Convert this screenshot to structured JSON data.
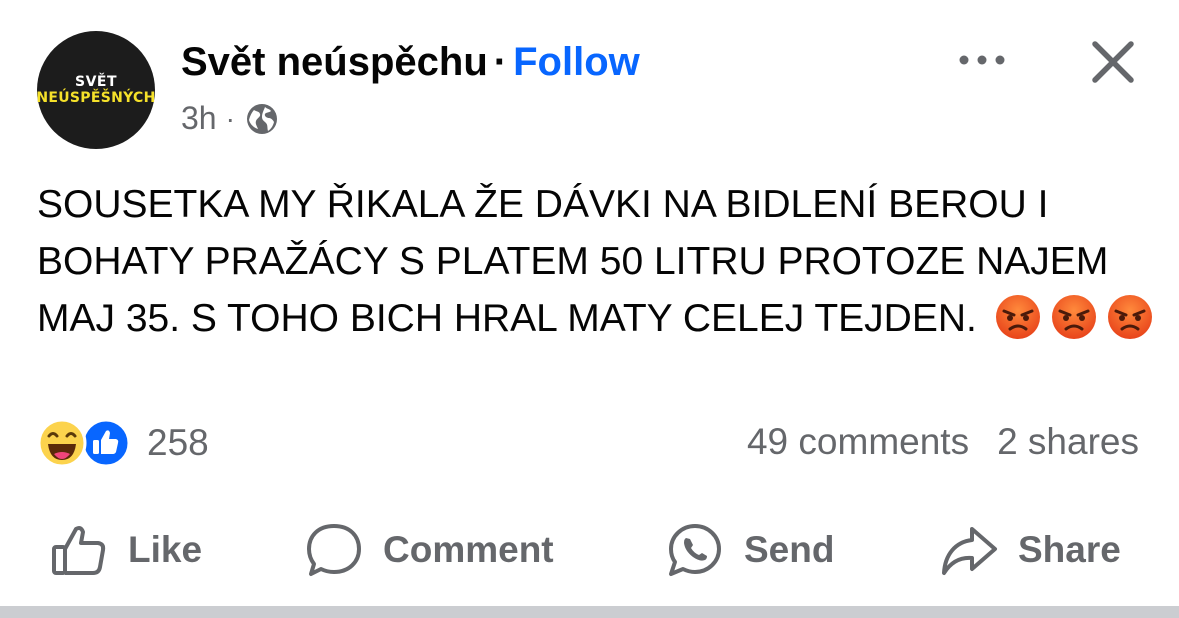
{
  "header": {
    "avatar_line1": "SVĚT",
    "avatar_line2": "NEÚSPĚŠNÝCH",
    "page_name": "Svět neúspěchu",
    "separator": "·",
    "follow_label": "Follow",
    "time": "3h",
    "meta_separator": "·",
    "audience_icon": "globe-icon",
    "more_icon": "more-horizontal-icon",
    "close_icon": "close-icon"
  },
  "post": {
    "text": "SOUSETKA MY ŘIKALA ŽE DÁVKI NA BIDLENÍ BEROU I BOHATY PRAŽÁCY S PLATEM 50 LITRU PROTOZE NAJEM MAJ 35. S TOHO BICH HRAL MATY CELEJ TEJDEN.",
    "emojis": [
      "angry-face",
      "angry-face",
      "angry-face"
    ]
  },
  "stats": {
    "reaction_icons": [
      "haha-icon",
      "like-icon"
    ],
    "reaction_count": "258",
    "comments": "49 comments",
    "shares": "2 shares"
  },
  "actions": {
    "like": "Like",
    "comment": "Comment",
    "send": "Send",
    "share": "Share"
  },
  "colors": {
    "follow": "#0866ff",
    "secondary_text": "#65676b",
    "like_blue": "#0866ff",
    "haha_yellow": "#fcd34d",
    "angry_orange": "#f26a1b"
  }
}
